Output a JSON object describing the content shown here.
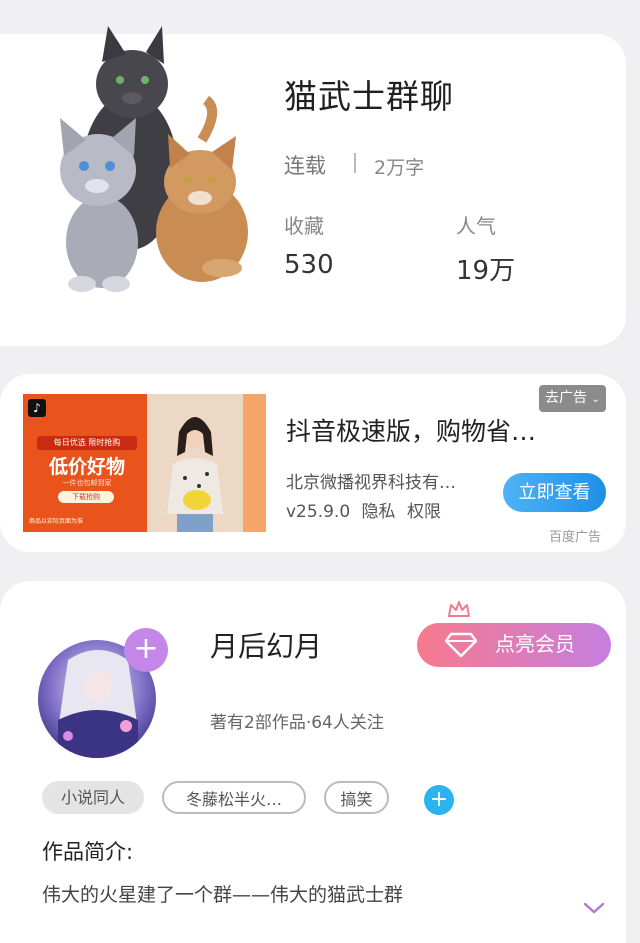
{
  "book": {
    "title": "猫武士群聊",
    "status": "连载",
    "word_count": "2万字",
    "collect_label": "收藏",
    "collect_value": "530",
    "popularity_label": "人气",
    "popularity_value": "19万"
  },
  "ad": {
    "go_ad_label": "去广告",
    "title": "抖音极速版，购物省…",
    "company": "北京微播视界科技有…",
    "version": "v25.9.0",
    "privacy": "隐私",
    "permission": "权限",
    "cta": "立即查看",
    "source": "百度广告",
    "image": {
      "top_tag": "每日优选 限时抢购",
      "headline": "低价好物",
      "sub": "一件也包邮到家",
      "btn": "下载抢购",
      "foot": "商品以实际页面为准"
    }
  },
  "author": {
    "name": "月后幻月",
    "meta": "著有2部作品·64人关注",
    "vip_label": "点亮会员",
    "tags": [
      "小说同人",
      "冬藤松半火…",
      "搞笑"
    ],
    "intro_heading": "作品简介:",
    "intro_text": "伟大的火星建了一个群——伟大的猫武士群"
  },
  "colors": {
    "background": "#f0eff1",
    "cta_blue": "#1e8fe6",
    "vip_pink": "#f77a8c",
    "vip_purple": "#c57ee0",
    "tag_add_blue": "#29b3ef"
  }
}
